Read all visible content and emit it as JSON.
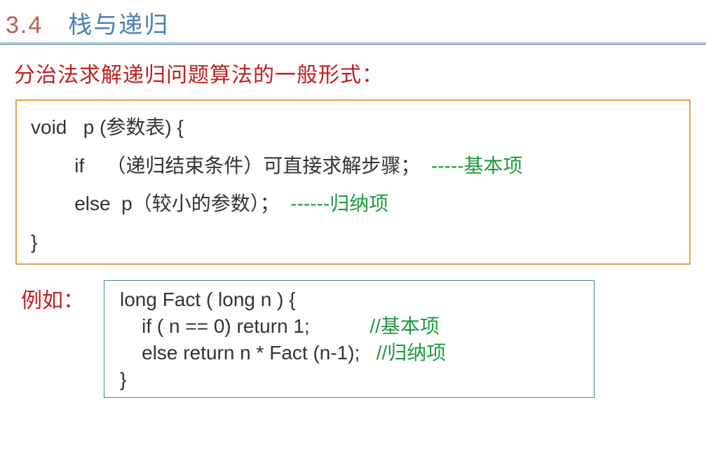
{
  "header": {
    "section_num": "3.4",
    "section_title": "栈与递归"
  },
  "subtitle": "分治法求解递归问题算法的一般形式：",
  "pseudo": {
    "line1": "void   p (参数表) {",
    "line2_indent": "        if    （递归结束条件）可直接求解步骤；",
    "line2_dashes": "  -----",
    "line2_tag": "基本项",
    "line3_indent": "        else  p（较小的参数）；",
    "line3_dashes": "  ------",
    "line3_tag": "归纳项",
    "line4": "}"
  },
  "example": {
    "label": "例如：",
    "line1": "long Fact ( long n ) {",
    "line2_code": "    if ( n == 0) return 1;           ",
    "line2_comment": "//基本项",
    "line3_code": "    else return n * Fact (n-1);   ",
    "line3_comment": "//归纳项",
    "line4": "}"
  }
}
